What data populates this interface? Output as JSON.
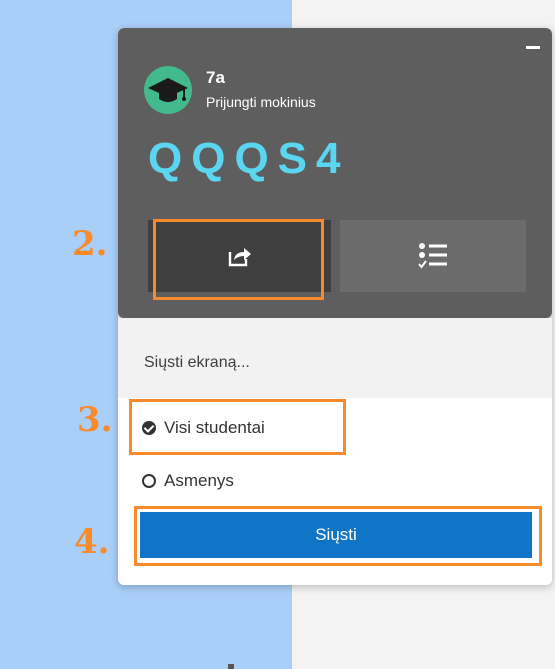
{
  "class": {
    "name": "7a",
    "subtitle": "Prijungti mokinius",
    "code": "QQQS4"
  },
  "send_screen": {
    "title": "Siųsti ekraną...",
    "options": [
      {
        "label": "Visi studentai",
        "selected": true
      },
      {
        "label": "Asmenys",
        "selected": false
      }
    ],
    "send_button": "Siųsti"
  },
  "annotations": {
    "step2": "2.",
    "step3": "3.",
    "step4": "4."
  },
  "colors": {
    "highlight": "#f78a2b",
    "code": "#5bd6f0",
    "primary_button": "#1175c7",
    "avatar": "#43b98e"
  },
  "icons": [
    "share-screen-icon",
    "checklist-icon",
    "graduation-cap-icon",
    "minimize-icon"
  ]
}
